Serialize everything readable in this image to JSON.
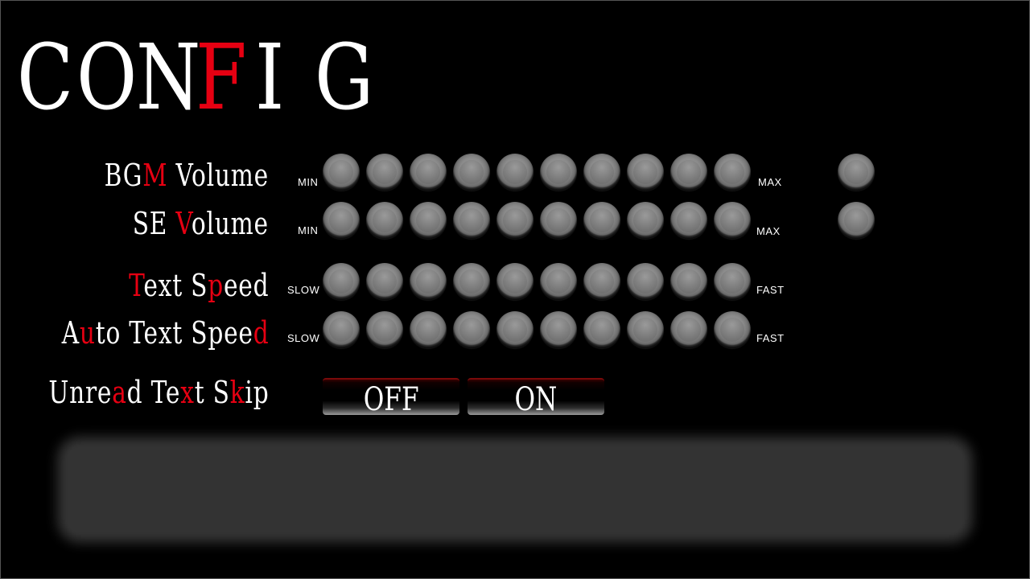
{
  "title": {
    "letters": [
      {
        "ch": "C",
        "color": "#ffffff"
      },
      {
        "ch": "O",
        "color": "#ffffff"
      },
      {
        "ch": "N",
        "color": "#ffffff"
      },
      {
        "ch": "F",
        "color": "#e60012"
      },
      {
        "ch": "I",
        "color": "#ffffff"
      },
      {
        "ch": "G",
        "color": "#ffffff"
      }
    ]
  },
  "colors": {
    "accent_red": "#e60012",
    "background": "#000000",
    "text": "#ffffff",
    "knob": "#8a8a8a",
    "message_box": "#333333"
  },
  "settings": {
    "bgm_volume": {
      "label_parts": [
        {
          "text": "BG",
          "red": false
        },
        {
          "text": "M",
          "red": true
        },
        {
          "text": " Volume",
          "red": false
        }
      ],
      "min_label": "MIN",
      "max_label": "MAX",
      "steps": 10
    },
    "se_volume": {
      "label_parts": [
        {
          "text": "SE ",
          "red": false
        },
        {
          "text": "V",
          "red": true
        },
        {
          "text": "olume",
          "red": false
        }
      ],
      "min_label": "MIN",
      "max_label": "MAX",
      "steps": 10
    },
    "text_speed": {
      "label_parts": [
        {
          "text": "T",
          "red": true
        },
        {
          "text": "ext S",
          "red": false
        },
        {
          "text": "p",
          "red": true
        },
        {
          "text": "eed",
          "red": false
        }
      ],
      "min_label": "SLOW",
      "max_label": "FAST",
      "steps": 10
    },
    "auto_text_speed": {
      "label_parts": [
        {
          "text": "A",
          "red": false
        },
        {
          "text": "u",
          "red": true
        },
        {
          "text": "to Text Spee",
          "red": false
        },
        {
          "text": "d",
          "red": true
        }
      ],
      "min_label": "SLOW",
      "max_label": "FAST",
      "steps": 10
    },
    "unread_text_skip": {
      "label_parts": [
        {
          "text": "Unre",
          "red": false
        },
        {
          "text": "a",
          "red": true
        },
        {
          "text": "d Te",
          "red": false
        },
        {
          "text": "x",
          "red": true
        },
        {
          "text": "t S",
          "red": false
        },
        {
          "text": "k",
          "red": true
        },
        {
          "text": "ip",
          "red": false
        }
      ],
      "off_label": "OFF",
      "on_label": "ON"
    }
  },
  "icons": {
    "knob": "round-knob-icon"
  }
}
